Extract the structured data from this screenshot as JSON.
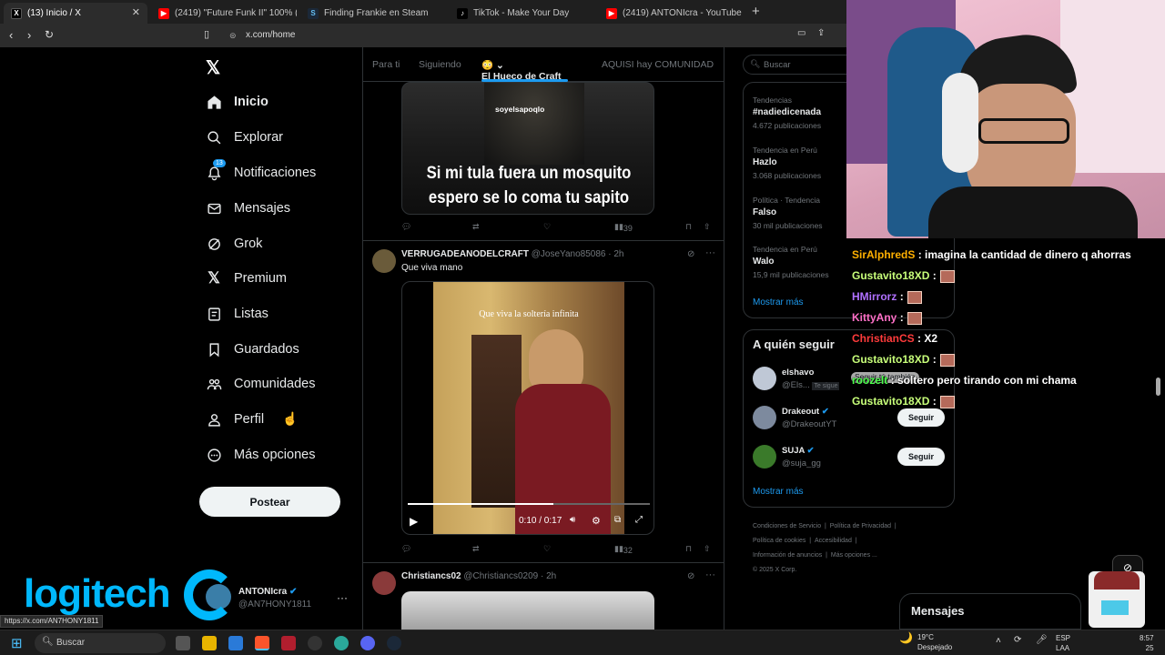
{
  "browser": {
    "tabs": [
      {
        "label": "(13) Inicio / X",
        "icon": "x-logo-icon",
        "active": true
      },
      {
        "label": "(2419) \"Future Funk II\" 100% (Demo",
        "icon": "youtube-icon"
      },
      {
        "label": "Finding Frankie en Steam",
        "icon": "steam-icon"
      },
      {
        "label": "TikTok - Make Your Day",
        "icon": "tiktok-icon"
      },
      {
        "label": "(2419) ANTONIcra - YouTube",
        "icon": "youtube-icon"
      }
    ],
    "url": "x.com/home",
    "status_url": "https://x.com/AN7HONY1811"
  },
  "nav": {
    "items": [
      {
        "label": "Inicio",
        "icon": "home-icon"
      },
      {
        "label": "Explorar",
        "icon": "search-icon"
      },
      {
        "label": "Notificaciones",
        "icon": "bell-icon",
        "badge": "13"
      },
      {
        "label": "Mensajes",
        "icon": "mail-icon"
      },
      {
        "label": "Grok",
        "icon": "grok-icon"
      },
      {
        "label": "Premium",
        "icon": "x-logo-icon"
      },
      {
        "label": "Listas",
        "icon": "list-icon"
      },
      {
        "label": "Guardados",
        "icon": "bookmark-icon"
      },
      {
        "label": "Comunidades",
        "icon": "communities-icon"
      },
      {
        "label": "Perfil",
        "icon": "person-icon"
      },
      {
        "label": "Más opciones",
        "icon": "more-circle-icon"
      }
    ],
    "post_label": "Postear",
    "account": {
      "name": "ANTONIcra",
      "handle": "@AN7HONY1811"
    }
  },
  "feed": {
    "tabs": [
      "Para ti",
      "Siguiendo",
      "El Hueco de Craft",
      "AQUISI hay COMUNIDAD"
    ],
    "post1": {
      "watermark": "soyelsapoqlo",
      "caption_line1": "Si mi tula fuera un mosquito",
      "caption_line2": "espero se lo coma tu sapito",
      "views": "39"
    },
    "post2": {
      "author": "VERRUGADEANODELCRAFT",
      "handle": "@JoseYano85086",
      "time": "· 2h",
      "text": "Que viva mano",
      "video_caption": "Que viva la soltería infinita",
      "video_time": "0:10 / 0:17",
      "views": "32",
      "progress": 0.6
    },
    "post3": {
      "author": "Christiancs02",
      "handle": "@Christiancs0209",
      "time": "· 2h"
    }
  },
  "right": {
    "search_placeholder": "Buscar",
    "trends": [
      {
        "context": "Tendencias",
        "name": "#nadiedicenada",
        "count": "4.672 publicaciones"
      },
      {
        "context": "Tendencia en Perú",
        "name": "Hazlo",
        "count": "3.068 publicaciones"
      },
      {
        "context": "Política · Tendencia",
        "name": "Falso",
        "count": "30 mil publicaciones"
      },
      {
        "context": "Tendencia en Perú",
        "name": "Walo",
        "count": "15,9 mil publicaciones"
      }
    ],
    "show_more": "Mostrar más",
    "who_to_follow_title": "A quién seguir",
    "who_to_follow": [
      {
        "name": "elshavo",
        "handle": "@Els...",
        "badge": "Te sigue",
        "button": "Seguir tú también"
      },
      {
        "name": "Drakeout",
        "handle": "@DrakeoutYT",
        "button": "Seguir"
      },
      {
        "name": "SUJA",
        "handle": "@suja_gg",
        "button": "Seguir"
      }
    ],
    "show_more_2": "Mostrar más",
    "footer": [
      "Condiciones de Servicio",
      "Política de Privacidad",
      "Política de cookies",
      "Accesibilidad",
      "Información de anuncios",
      "Más opciones ...",
      "© 2025 X Corp."
    ],
    "messages_label": "Mensajes"
  },
  "chat": [
    {
      "user": "SirAlphredS",
      "color": "#ffb000",
      "text": ": imagina la cantidad de dinero q ahorras",
      "emote": false
    },
    {
      "user": "Gustavito18XD",
      "color": "#c8ff7a",
      "text": ":",
      "emote": true
    },
    {
      "user": "HMirrorz",
      "color": "#b070ff",
      "text": ":",
      "emote": true
    },
    {
      "user": "KittyAny",
      "color": "#ff70c8",
      "text": ":",
      "emote": true
    },
    {
      "user": "ChristianCS",
      "color": "#ff3b3b",
      "text": ": X2",
      "emote": false
    },
    {
      "user": "Gustavito18XD",
      "color": "#c8ff7a",
      "text": ":",
      "emote": true
    },
    {
      "user": "roozelt",
      "color": "#4cff4c",
      "text": ": soltero pero tirando con mi chama",
      "emote": false
    },
    {
      "user": "Gustavito18XD",
      "color": "#c8ff7a",
      "text": ":",
      "emote": true
    }
  ],
  "overlay": {
    "brand": "logitech"
  },
  "taskbar": {
    "search": "Buscar",
    "weather_temp": "19°C",
    "weather_desc": "Despejado",
    "lang1": "ESP",
    "lang2": "LAA",
    "time": "8:57",
    "date": "25"
  }
}
